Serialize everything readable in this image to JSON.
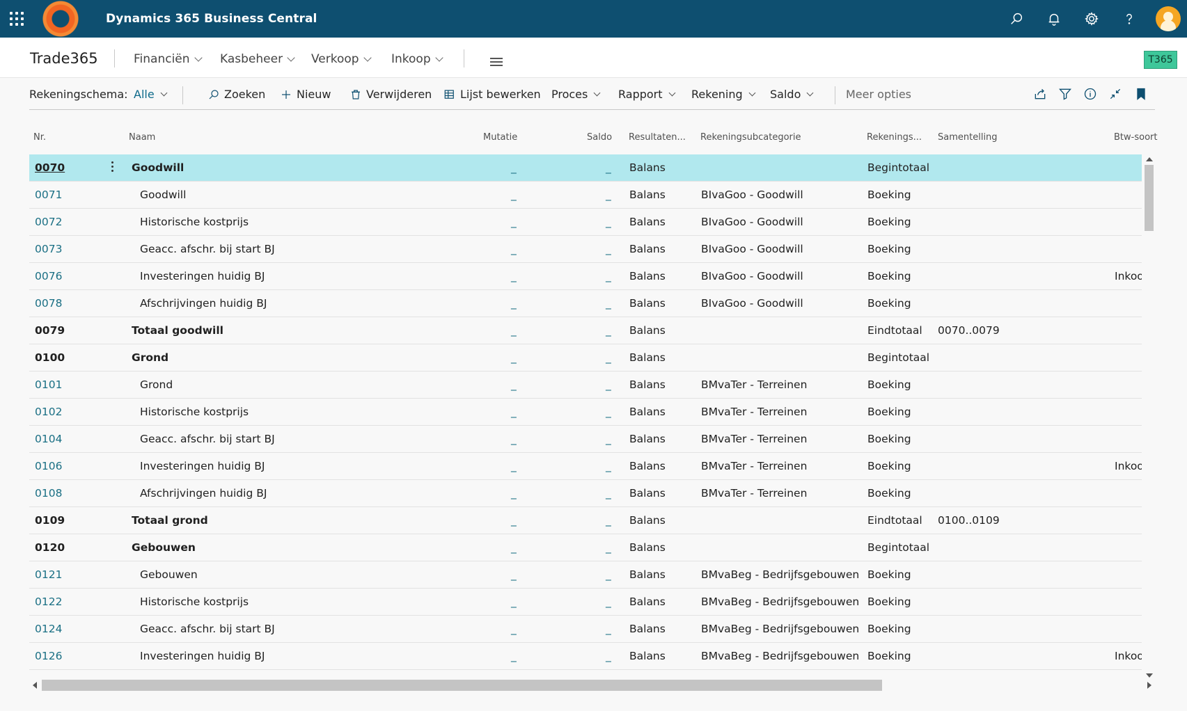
{
  "app": {
    "title": "Dynamics 365 Business Central"
  },
  "nav": {
    "company": "Trade365",
    "items": [
      {
        "label": "Financiën"
      },
      {
        "label": "Kasbeheer"
      },
      {
        "label": "Verkoop"
      },
      {
        "label": "Inkoop"
      }
    ],
    "badge": "T365"
  },
  "actions": {
    "schema_label": "Rekeningschema:",
    "schema_value": "Alle",
    "search": "Zoeken",
    "new": "Nieuw",
    "delete": "Verwijderen",
    "edit_list": "Lijst bewerken",
    "process": "Proces",
    "report": "Rapport",
    "account": "Rekening",
    "balance": "Saldo",
    "more": "Meer opties"
  },
  "table": {
    "headers": {
      "nr": "Nr.",
      "name": "Naam",
      "mutatie": "Mutatie",
      "saldo": "Saldo",
      "resultaat": "Resultaten...",
      "subcat": "Rekeningsubcategorie",
      "type": "Rekenings...",
      "totaling": "Samentelling",
      "vat": "Btw-soort"
    },
    "rows": [
      {
        "nr": "0070",
        "name": "Goodwill",
        "mutatie": "_",
        "saldo": "_",
        "resultaat": "Balans",
        "subcat": "",
        "type": "Begintotaal",
        "totaling": "",
        "vat": "",
        "bold": true,
        "selected": true
      },
      {
        "nr": "0071",
        "name": "Goodwill",
        "mutatie": "_",
        "saldo": "_",
        "resultaat": "Balans",
        "subcat": "BIvaGoo - Goodwill",
        "type": "Boeking",
        "totaling": "",
        "vat": "",
        "bold": false
      },
      {
        "nr": "0072",
        "name": "Historische kostprijs",
        "mutatie": "_",
        "saldo": "_",
        "resultaat": "Balans",
        "subcat": "BIvaGoo - Goodwill",
        "type": "Boeking",
        "totaling": "",
        "vat": "",
        "bold": false
      },
      {
        "nr": "0073",
        "name": "Geacc. afschr. bij start BJ",
        "mutatie": "_",
        "saldo": "_",
        "resultaat": "Balans",
        "subcat": "BIvaGoo - Goodwill",
        "type": "Boeking",
        "totaling": "",
        "vat": "",
        "bold": false
      },
      {
        "nr": "0076",
        "name": "Investeringen huidig BJ",
        "mutatie": "_",
        "saldo": "_",
        "resultaat": "Balans",
        "subcat": "BIvaGoo - Goodwill",
        "type": "Boeking",
        "totaling": "",
        "vat": "Inkoo",
        "bold": false
      },
      {
        "nr": "0078",
        "name": "Afschrijvingen huidig BJ",
        "mutatie": "_",
        "saldo": "_",
        "resultaat": "Balans",
        "subcat": "BIvaGoo - Goodwill",
        "type": "Boeking",
        "totaling": "",
        "vat": "",
        "bold": false
      },
      {
        "nr": "0079",
        "name": "Totaal goodwill",
        "mutatie": "_",
        "saldo": "_",
        "resultaat": "Balans",
        "subcat": "",
        "type": "Eindtotaal",
        "totaling": "0070..0079",
        "vat": "",
        "bold": true
      },
      {
        "nr": "0100",
        "name": "Grond",
        "mutatie": "_",
        "saldo": "_",
        "resultaat": "Balans",
        "subcat": "",
        "type": "Begintotaal",
        "totaling": "",
        "vat": "",
        "bold": true
      },
      {
        "nr": "0101",
        "name": "Grond",
        "mutatie": "_",
        "saldo": "_",
        "resultaat": "Balans",
        "subcat": "BMvaTer - Terreinen",
        "type": "Boeking",
        "totaling": "",
        "vat": "",
        "bold": false
      },
      {
        "nr": "0102",
        "name": "Historische kostprijs",
        "mutatie": "_",
        "saldo": "_",
        "resultaat": "Balans",
        "subcat": "BMvaTer - Terreinen",
        "type": "Boeking",
        "totaling": "",
        "vat": "",
        "bold": false
      },
      {
        "nr": "0104",
        "name": "Geacc. afschr. bij start BJ",
        "mutatie": "_",
        "saldo": "_",
        "resultaat": "Balans",
        "subcat": "BMvaTer - Terreinen",
        "type": "Boeking",
        "totaling": "",
        "vat": "",
        "bold": false
      },
      {
        "nr": "0106",
        "name": "Investeringen huidig BJ",
        "mutatie": "_",
        "saldo": "_",
        "resultaat": "Balans",
        "subcat": "BMvaTer - Terreinen",
        "type": "Boeking",
        "totaling": "",
        "vat": "Inkoo",
        "bold": false
      },
      {
        "nr": "0108",
        "name": "Afschrijvingen huidig BJ",
        "mutatie": "_",
        "saldo": "_",
        "resultaat": "Balans",
        "subcat": "BMvaTer - Terreinen",
        "type": "Boeking",
        "totaling": "",
        "vat": "",
        "bold": false
      },
      {
        "nr": "0109",
        "name": "Totaal grond",
        "mutatie": "_",
        "saldo": "_",
        "resultaat": "Balans",
        "subcat": "",
        "type": "Eindtotaal",
        "totaling": "0100..0109",
        "vat": "",
        "bold": true
      },
      {
        "nr": "0120",
        "name": "Gebouwen",
        "mutatie": "_",
        "saldo": "_",
        "resultaat": "Balans",
        "subcat": "",
        "type": "Begintotaal",
        "totaling": "",
        "vat": "",
        "bold": true
      },
      {
        "nr": "0121",
        "name": "Gebouwen",
        "mutatie": "_",
        "saldo": "_",
        "resultaat": "Balans",
        "subcat": "BMvaBeg - Bedrijfsgebouwen",
        "type": "Boeking",
        "totaling": "",
        "vat": "",
        "bold": false
      },
      {
        "nr": "0122",
        "name": "Historische kostprijs",
        "mutatie": "_",
        "saldo": "_",
        "resultaat": "Balans",
        "subcat": "BMvaBeg - Bedrijfsgebouwen",
        "type": "Boeking",
        "totaling": "",
        "vat": "",
        "bold": false
      },
      {
        "nr": "0124",
        "name": "Geacc. afschr. bij start BJ",
        "mutatie": "_",
        "saldo": "_",
        "resultaat": "Balans",
        "subcat": "BMvaBeg - Bedrijfsgebouwen",
        "type": "Boeking",
        "totaling": "",
        "vat": "",
        "bold": false
      },
      {
        "nr": "0126",
        "name": "Investeringen huidig BJ",
        "mutatie": "_",
        "saldo": "_",
        "resultaat": "Balans",
        "subcat": "BMvaBeg - Bedrijfsgebouwen",
        "type": "Boeking",
        "totaling": "",
        "vat": "Inkoo",
        "bold": false
      }
    ]
  },
  "colors": {
    "topbar": "#0e4f70",
    "selected_row": "#b1e8ee",
    "link": "#1a6f84",
    "badge": "#3ec79a"
  }
}
